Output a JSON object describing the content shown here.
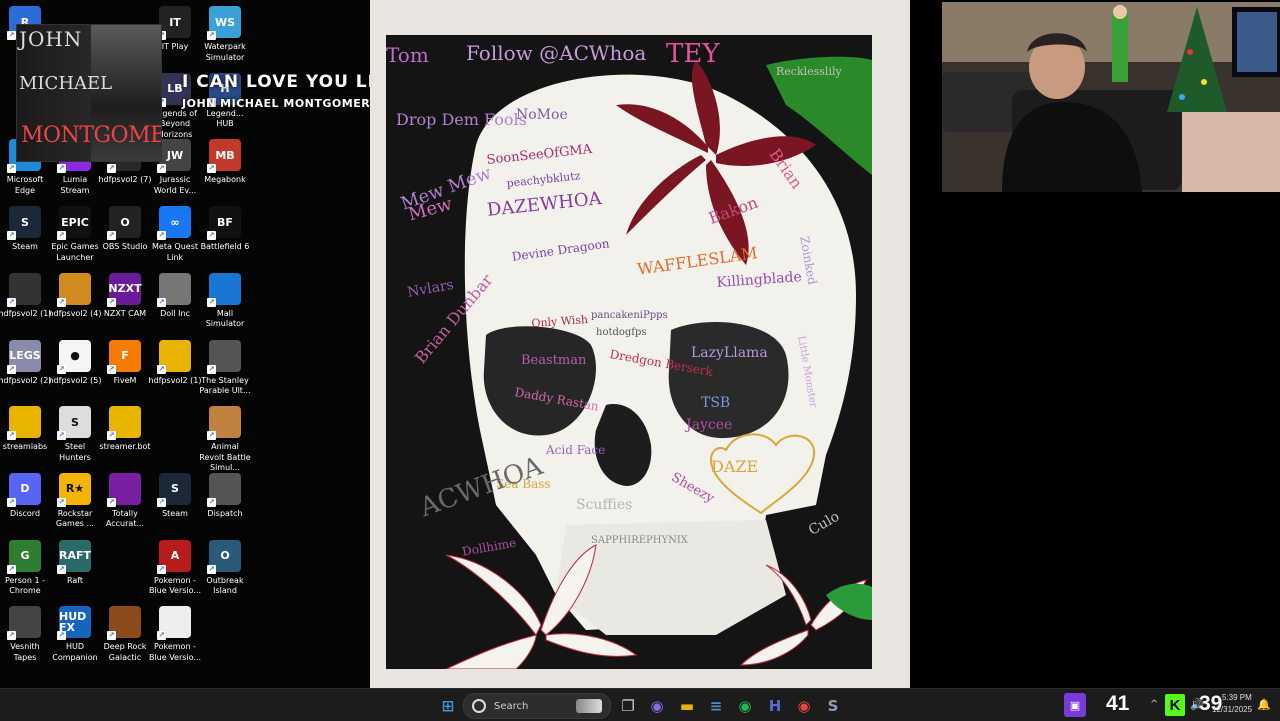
{
  "desktop": {
    "icons": [
      {
        "label": "Re...",
        "color": "#2b6cd8",
        "glyph": "R"
      },
      {
        "label": "IT Play",
        "color": "#222",
        "glyph": "IT"
      },
      {
        "label": "Waterpark Simulator",
        "color": "#3aa0d8",
        "glyph": "WS"
      },
      {
        "label": "Legends of Beyond Horizons",
        "color": "#335",
        "glyph": "LB"
      },
      {
        "label": "Legend... HUB",
        "color": "#2a4a8a",
        "glyph": "H"
      },
      {
        "label": "Microsoft Edge",
        "color": "#1f8ad8",
        "glyph": "e"
      },
      {
        "label": "Lumia Stream",
        "color": "#8a2be2",
        "glyph": "L"
      },
      {
        "label": "hdfpsvol2 (7)",
        "color": "#2a2a2a",
        "glyph": ""
      },
      {
        "label": "Jurassic World Ev...",
        "color": "#444",
        "glyph": "JW"
      },
      {
        "label": "Megabonk",
        "color": "#c0392b",
        "glyph": "MB"
      },
      {
        "label": "Steam",
        "color": "#1b2838",
        "glyph": "S"
      },
      {
        "label": "Epic Games Launcher",
        "color": "#111",
        "glyph": "EPIC"
      },
      {
        "label": "OBS Studio",
        "color": "#222",
        "glyph": "O"
      },
      {
        "label": "Meta Quest Link",
        "color": "#1877f2",
        "glyph": "∞"
      },
      {
        "label": "Battlefield 6",
        "color": "#111",
        "glyph": "BF"
      },
      {
        "label": "hdfpsvol2 (1)",
        "color": "#333",
        "glyph": ""
      },
      {
        "label": "hdfpsvol2 (4)",
        "color": "#d08a20",
        "glyph": ""
      },
      {
        "label": "NZXT CAM",
        "color": "#6a1b9a",
        "glyph": "NZXT"
      },
      {
        "label": "Doll Inc",
        "color": "#777",
        "glyph": ""
      },
      {
        "label": "Mall Simulator",
        "color": "#1976d2",
        "glyph": ""
      },
      {
        "label": "hdfpsvol2 (2)",
        "color": "#8a8aaa",
        "glyph": "LEGS"
      },
      {
        "label": "hdfpsvol2 (5)",
        "color": "#f5f5f5",
        "glyph": "●"
      },
      {
        "label": "FiveM",
        "color": "#f57c00",
        "glyph": "F"
      },
      {
        "label": "hdfpsvol2 (1)",
        "color": "#e8b400",
        "glyph": ""
      },
      {
        "label": "The Stanley Parable Ult...",
        "color": "#555",
        "glyph": ""
      },
      {
        "label": "streamlabs",
        "color": "#e8b400",
        "glyph": ""
      },
      {
        "label": "Steel Hunters",
        "color": "#ddd",
        "glyph": "S"
      },
      {
        "label": "streamer.bot",
        "color": "#e8b400",
        "glyph": ""
      },
      {
        "label": "Animal Revolt Battle Simul...",
        "color": "#c08040",
        "glyph": ""
      },
      {
        "label": "Discord",
        "color": "#5865f2",
        "glyph": "D"
      },
      {
        "label": "Rockstar Games ...",
        "color": "#f4b400",
        "glyph": "R★"
      },
      {
        "label": "Totally Accurat...",
        "color": "#7a1fa2",
        "glyph": ""
      },
      {
        "label": "Steam",
        "color": "#1b2838",
        "glyph": "S"
      },
      {
        "label": "Dispatch",
        "color": "#555",
        "glyph": ""
      },
      {
        "label": "Person 1 - Chrome",
        "color": "#2e7d32",
        "glyph": "G"
      },
      {
        "label": "Raft",
        "color": "#2a6a6a",
        "glyph": "RAFT"
      },
      {
        "label": "Pokemon - Blue Versio...",
        "color": "#b71c1c",
        "glyph": "A"
      },
      {
        "label": "Outbreak Island",
        "color": "#2a5a7a",
        "glyph": "O"
      },
      {
        "label": "Vesnith Tapes",
        "color": "#444",
        "glyph": ""
      },
      {
        "label": "HUD Companion",
        "color": "#1565c0",
        "glyph": "HUD FX"
      },
      {
        "label": "Deep Rock Galactic",
        "color": "#8a4a1a",
        "glyph": ""
      },
      {
        "label": "Pokemon - Blue Versio...",
        "color": "#eee",
        "glyph": ""
      }
    ]
  },
  "now_playing": {
    "album_line1": "JOHN",
    "album_line2": "MICHAEL",
    "album_line3": "MONTGOMERY",
    "song_title": "I CAN LOVE YOU LIKE THAT",
    "artist": "JOHN MICHAEL MONTGOMERY"
  },
  "painting": {
    "signatures": [
      {
        "text": "Tom",
        "color": "#c06ad0"
      },
      {
        "text": "Follow @ACWhoa",
        "color": "#c79adf"
      },
      {
        "text": "TEY",
        "color": "#e0559a"
      },
      {
        "text": "Recklesslily",
        "color": "#c0c0c0"
      },
      {
        "text": "Drop Dem Fools",
        "color": "#b57fd0"
      },
      {
        "text": "NoMoe",
        "color": "#7a5aa8"
      },
      {
        "text": "Brian",
        "color": "#e15a8a"
      },
      {
        "text": "SoonSeeOfGMA",
        "color": "#b02a6a"
      },
      {
        "text": "peachybklutz",
        "color": "#7a3fa8"
      },
      {
        "text": "DAZEWHOA",
        "color": "#8a3a9a"
      },
      {
        "text": "Bakon",
        "color": "#c44a7a"
      },
      {
        "text": "Zoinked",
        "color": "#b094d0"
      },
      {
        "text": "Mew",
        "color": "#d070c0"
      },
      {
        "text": "Devine Dragoon",
        "color": "#7a3fa8"
      },
      {
        "text": "WAFFLESLAM",
        "color": "#e46a2a"
      },
      {
        "text": "Killingblade",
        "color": "#9a4ab0"
      },
      {
        "text": "Only Wish",
        "color": "#b02a3a"
      },
      {
        "text": "pancakeniPpps",
        "color": "#6a4a8a"
      },
      {
        "text": "hotdogfps",
        "color": "#555555"
      },
      {
        "text": "Beastman",
        "color": "#b85ab0"
      },
      {
        "text": "Dredgon Berserk",
        "color": "#c0304a"
      },
      {
        "text": "LazyLlama",
        "color": "#b79ad8"
      },
      {
        "text": "Daddy Rastan",
        "color": "#d06ab0"
      },
      {
        "text": "TSB",
        "color": "#7a9ad8"
      },
      {
        "text": "Jaycee",
        "color": "#b050a0"
      },
      {
        "text": "Acid Face",
        "color": "#a060c0"
      },
      {
        "text": "DAZE",
        "color": "#d8a838"
      },
      {
        "text": "Sea Bass",
        "color": "#d8a838"
      },
      {
        "text": "Sheezy",
        "color": "#b04a9a"
      },
      {
        "text": "Scuffies",
        "color": "#b6b6b6"
      },
      {
        "text": "SAPPHIREPHYNIX",
        "color": "#8a8a8a"
      },
      {
        "text": "Dollhime",
        "color": "#b050a0"
      },
      {
        "text": "ACWHOA",
        "color": "#6a6a6a"
      },
      {
        "text": "Culo",
        "color": "#c0c0c0"
      },
      {
        "text": "Little Monster",
        "color": "#c8a0e0"
      },
      {
        "text": "Mew Mew",
        "color": "#b07fd0"
      },
      {
        "text": "Nvlars",
        "color": "#9060b0"
      },
      {
        "text": "Brian Dunbar",
        "color": "#c060a0"
      }
    ]
  },
  "taskbar": {
    "search_placeholder": "Search",
    "viewer_count": "41",
    "kick_count": "39",
    "time": "5:39 PM",
    "date": "12/31/2025",
    "pinned": [
      {
        "name": "windows-start-icon",
        "color": "#3a96dd",
        "glyph": "⊞"
      },
      {
        "name": "task-view-icon",
        "color": "#cccccc",
        "glyph": "❐"
      },
      {
        "name": "copilot-icon",
        "color": "#8a6ae0",
        "glyph": "◉"
      },
      {
        "name": "file-explorer-icon",
        "color": "#e8b400",
        "glyph": "▬"
      },
      {
        "name": "notepad-icon",
        "color": "#4a90d0",
        "glyph": "≡"
      },
      {
        "name": "spotify-icon",
        "color": "#1db954",
        "glyph": "◉"
      },
      {
        "name": "hud-fx-icon",
        "color": "#5a6ad8",
        "glyph": "H"
      },
      {
        "name": "chrome-icon",
        "color": "#e04a3a",
        "glyph": "◉"
      },
      {
        "name": "steam-taskbar-icon",
        "color": "#8aa0b8",
        "glyph": "S"
      }
    ]
  }
}
